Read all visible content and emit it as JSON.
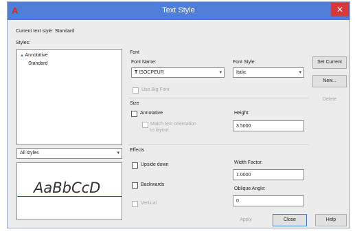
{
  "window": {
    "title": "Text Style",
    "close_label": "✕",
    "app_icon": "autocad-a-icon"
  },
  "current_style": {
    "label": "Current text style:",
    "value": "Standard"
  },
  "styles": {
    "label": "Styles:",
    "items": [
      {
        "label": "Annotative",
        "icon": "annotative-icon",
        "icon_glyph": "▲"
      },
      {
        "label": "Standard"
      }
    ]
  },
  "filter": {
    "value": "All styles",
    "arrow": "▾"
  },
  "preview": {
    "sample_text": "AaBbCcD"
  },
  "font": {
    "group_label": "Font",
    "font_name_label": "Font Name:",
    "font_name_value": "ISOCPEUR",
    "font_icon_glyph": "Ŧ",
    "font_style_label": "Font Style:",
    "font_style_value": "Italic",
    "use_big_font_label": "Use Big Font",
    "arrow": "▾"
  },
  "size": {
    "group_label": "Size",
    "annotative_label": "Annotative",
    "match_label_line1": "Match text orientation",
    "match_label_line2": "to layout",
    "height_label": "Height:",
    "height_value": "3.5000"
  },
  "effects": {
    "group_label": "Effects",
    "upside_down_label": "Upside down",
    "backwards_label": "Backwards",
    "vertical_label": "Vertical",
    "width_factor_label": "Width Factor:",
    "width_factor_value": "1.0000",
    "oblique_angle_label": "Oblique Angle:",
    "oblique_angle_value": "0"
  },
  "buttons": {
    "set_current": "Set Current",
    "new": "New...",
    "delete": "Delete",
    "apply": "Apply",
    "close": "Close",
    "help": "Help"
  },
  "colors": {
    "titlebar": "#4f7ed8",
    "close": "#d9383b",
    "preview_line": "#d0151c",
    "app_icon": "#d8232a"
  }
}
